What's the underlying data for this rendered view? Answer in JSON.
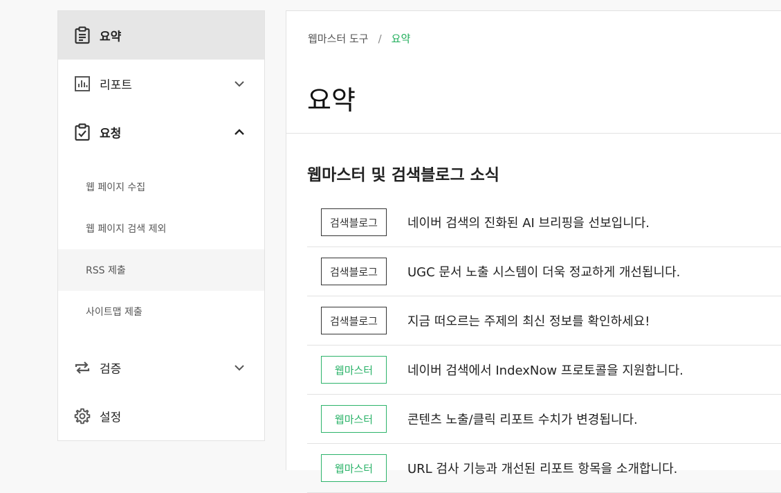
{
  "sidebar": {
    "items": [
      {
        "label": "요약",
        "icon": "clipboard-icon",
        "active": true
      },
      {
        "label": "리포트",
        "icon": "bar-chart-icon",
        "expanded": false
      },
      {
        "label": "요청",
        "icon": "clipboard-check-icon",
        "expanded": true
      },
      {
        "label": "검증",
        "icon": "repeat-icon",
        "expanded": false
      },
      {
        "label": "설정",
        "icon": "gear-icon"
      }
    ],
    "sub_items": [
      {
        "label": "웹 페이지 수집"
      },
      {
        "label": "웹 페이지 검색 제외"
      },
      {
        "label": "RSS 제출"
      },
      {
        "label": "사이트맵 제출"
      }
    ]
  },
  "breadcrumb": {
    "root": "웹마스터 도구",
    "separator": "/",
    "current": "요약"
  },
  "main": {
    "title": "요약",
    "section_title": "웹마스터 및 검색블로그 소식",
    "news": [
      {
        "badge": "검색블로그",
        "text": "네이버 검색의 진화된 AI 브리핑을 선보입니다."
      },
      {
        "badge": "검색블로그",
        "text": "UGC 문서 노출 시스템이 더욱 정교하게 개선됩니다."
      },
      {
        "badge": "검색블로그",
        "text": "지금 떠오르는 주제의 최신 정보를 확인하세요!"
      },
      {
        "badge": "웹마스터",
        "text": "네이버 검색에서 IndexNow 프로토콜을 지원합니다."
      },
      {
        "badge": "웹마스터",
        "text": "콘텐츠 노출/클릭 리포트 수치가 변경됩니다."
      },
      {
        "badge": "웹마스터",
        "text": "URL 검사 기능과 개선된 리포트 항목을 소개합니다."
      }
    ]
  },
  "colors": {
    "accent_green": "#2cb36a",
    "active_bg": "#e6e6e6"
  }
}
